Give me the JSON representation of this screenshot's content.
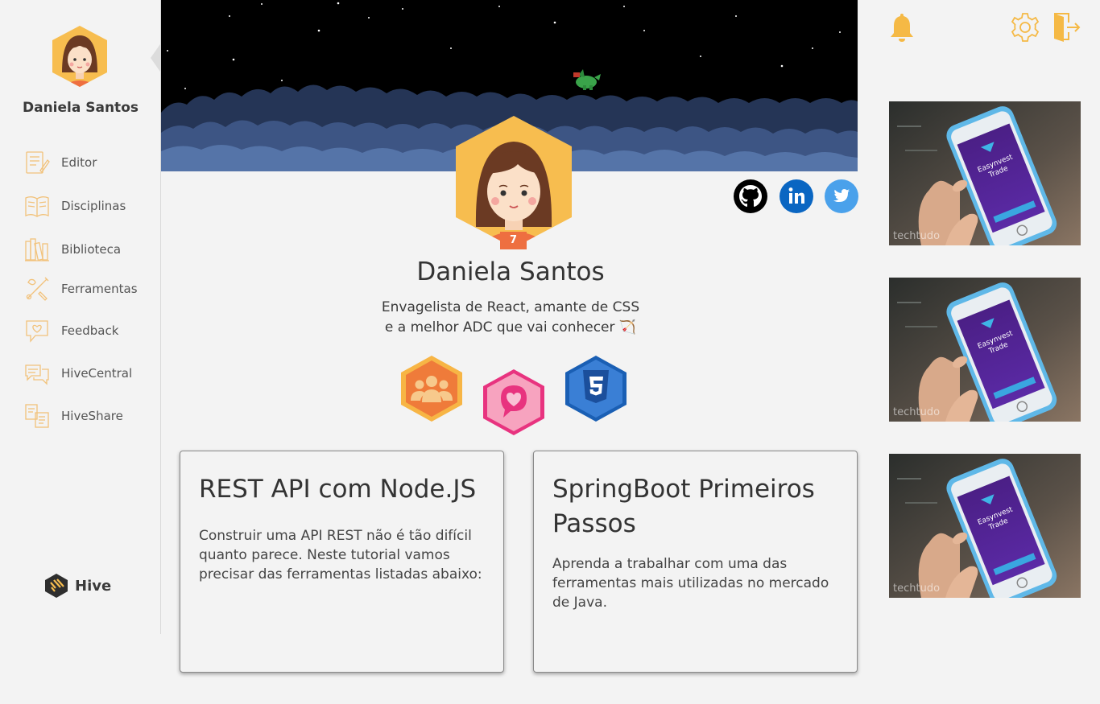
{
  "user": {
    "name": "Daniela Santos",
    "level": "7"
  },
  "sidebar": {
    "items": [
      {
        "label": "Editor",
        "icon": "editor-icon"
      },
      {
        "label": "Disciplinas",
        "icon": "book-icon"
      },
      {
        "label": "Biblioteca",
        "icon": "library-icon"
      },
      {
        "label": "Ferramentas",
        "icon": "tools-icon"
      },
      {
        "label": "Feedback",
        "icon": "feedback-icon"
      },
      {
        "label": "HiveCentral",
        "icon": "chat-icon"
      },
      {
        "label": "HiveShare",
        "icon": "share-icon"
      }
    ],
    "brand": "Hive"
  },
  "profile": {
    "bio_line1": "Envagelista de React, amante de CSS",
    "bio_line2": "e a melhor ADC que vai conhecer 🏹",
    "social": [
      "github-icon",
      "linkedin-icon",
      "twitter-icon"
    ],
    "badges": [
      "community-badge",
      "heart-chat-badge",
      "css3-badge"
    ]
  },
  "cards": [
    {
      "title": "REST API com Node.JS",
      "description": "Construir uma API REST não é tão difícil quanto parece. Neste tutorial vamos precisar das ferramentas listadas abaixo:"
    },
    {
      "title": "SpringBoot Primeiros Passos",
      "description": "Aprenda a trabalhar com uma das ferramentas mais utilizadas no mercado de Java."
    }
  ],
  "thumbnails": [
    {
      "watermark": "techtudo",
      "screen_title": "Easynvest Trade"
    },
    {
      "watermark": "techtudo",
      "screen_title": "Easynvest Trade"
    },
    {
      "watermark": "techtudo",
      "screen_title": "Easynvest Trade"
    }
  ],
  "colors": {
    "accent": "#f7bd4f",
    "level": "#ee6f40",
    "linkedin": "#0a66c2",
    "twitter": "#4aa1eb"
  }
}
